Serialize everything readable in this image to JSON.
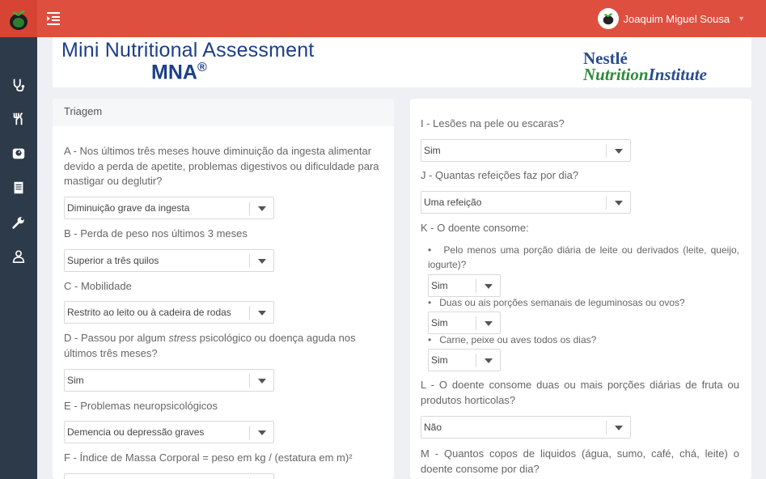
{
  "header": {
    "user_name": "Joaquim Miguel Sousa"
  },
  "banner": {
    "title_line1": "Mini Nutritional Assessment",
    "title_line2": "MNA",
    "registered": "®",
    "brand_line1": "Nestlé",
    "brand_line2_green": "Nutrition",
    "brand_line2_blue": "Institute"
  },
  "sidebar": [
    "stethoscope-icon",
    "cutlery-icon",
    "scale-icon",
    "document-icon",
    "wrench-icon",
    "user-icon"
  ],
  "triagem": {
    "heading": "Triagem",
    "A": {
      "question": "A - Nos últimos três meses houve diminuição da ingesta alimentar devido a perda de apetite, problemas digestivos ou dificuldade para mastigar ou deglutir?",
      "value": "Diminuição grave da ingesta"
    },
    "B": {
      "question": "B - Perda de peso nos últimos 3 meses",
      "value": "Superior a três quilos"
    },
    "C": {
      "question": "C - Mobilidade",
      "value": "Restrito ao leito ou à cadeira de rodas"
    },
    "D": {
      "question_pre": "D - Passou por algum ",
      "question_em": "stress",
      "question_post": " psicológico ou doença aguda nos últimos três meses?",
      "value": "Sim"
    },
    "E": {
      "question": "E - Problemas neuropsicológicos",
      "value": "Demencia ou depressão graves"
    },
    "F": {
      "question": "F - Índice de Massa Corporal = peso em kg / (estatura em m)²"
    }
  },
  "avaliacao": {
    "I": {
      "question": "I - Lesões na pele ou escaras?",
      "value": "Sim"
    },
    "J": {
      "question": "J - Quantas refeições faz por dia?",
      "value": "Uma refeição"
    },
    "K": {
      "question": "K - O doente consome:",
      "items": [
        {
          "text": "Pelo menos uma porção diária de leite ou derivados (leite, queijo, iogurte)?",
          "value": "Sim"
        },
        {
          "text": "Duas ou ais porções semanais de leguminosas ou ovos?",
          "value": "Sim"
        },
        {
          "text": "Carne, peixe ou aves todos os dias?",
          "value": "Sim"
        }
      ]
    },
    "L": {
      "question": "L - O doente consome duas ou mais porções diárias de fruta ou produtos horticolas?",
      "value": "Não"
    },
    "M": {
      "question": "M - Quantos copos de liquidos (água, sumo, café, chá, leite) o doente consome por dia?"
    }
  },
  "colors": {
    "header": "#df4f3f",
    "sidebar": "#2d3a4a",
    "title_blue": "#1b3f8a",
    "brand_green": "#2e8a3a"
  }
}
